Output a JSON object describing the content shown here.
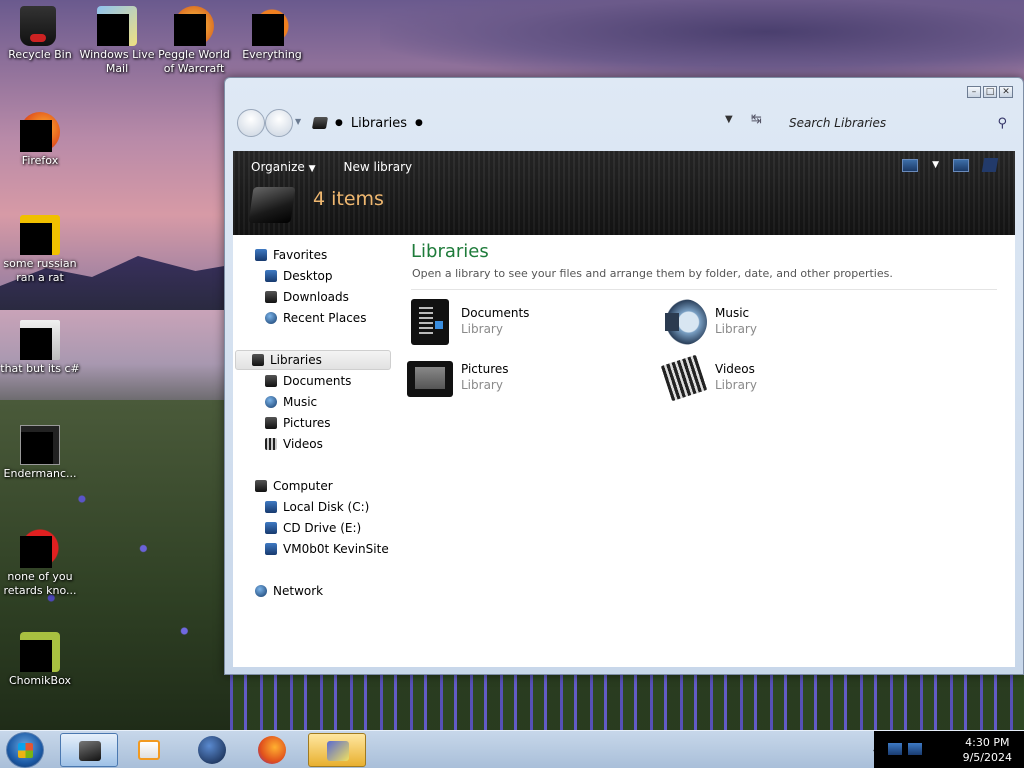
{
  "desktop": {
    "icons": [
      {
        "label": "Recycle Bin"
      },
      {
        "label": "Windows Live Mail"
      },
      {
        "label": "Peggle World of Warcraft"
      },
      {
        "label": "Everything"
      },
      {
        "label": "Firefox"
      },
      {
        "label": "some russian ran a rat"
      },
      {
        "label": "that but its c#"
      },
      {
        "label": "Endermanc..."
      },
      {
        "label": "none of you retards kno..."
      },
      {
        "label": "ChomikBox"
      }
    ]
  },
  "window": {
    "address": {
      "location": "Libraries"
    },
    "search": {
      "placeholder": "Search Libraries"
    },
    "toolbar": {
      "organize_label": "Organize",
      "new_library_label": "New library",
      "items_count": "4 items"
    },
    "navpane": {
      "favorites": {
        "label": "Favorites",
        "items": [
          "Desktop",
          "Downloads",
          "Recent Places"
        ]
      },
      "libraries": {
        "label": "Libraries",
        "items": [
          "Documents",
          "Music",
          "Pictures",
          "Videos"
        ]
      },
      "computer": {
        "label": "Computer",
        "items": [
          "Local Disk (C:)",
          "CD Drive (E:)",
          "VM0b0t KevinSite"
        ]
      },
      "network": {
        "label": "Network"
      }
    },
    "main": {
      "title": "Libraries",
      "subtitle": "Open a library to see your files and arrange them by folder, date, and other properties.",
      "libraries": [
        {
          "name": "Documents",
          "type": "Library",
          "icon": "documents-icon"
        },
        {
          "name": "Music",
          "type": "Library",
          "icon": "music-icon"
        },
        {
          "name": "Pictures",
          "type": "Library",
          "icon": "pictures-icon"
        },
        {
          "name": "Videos",
          "type": "Library",
          "icon": "videos-icon"
        }
      ]
    }
  },
  "taskbar": {
    "clock": {
      "time": "4:30 PM",
      "date": "9/5/2024"
    }
  },
  "colors": {
    "accent_title": "#1e7b3a",
    "items_count": "#f0b870",
    "taskbar": "#b6cae0"
  }
}
